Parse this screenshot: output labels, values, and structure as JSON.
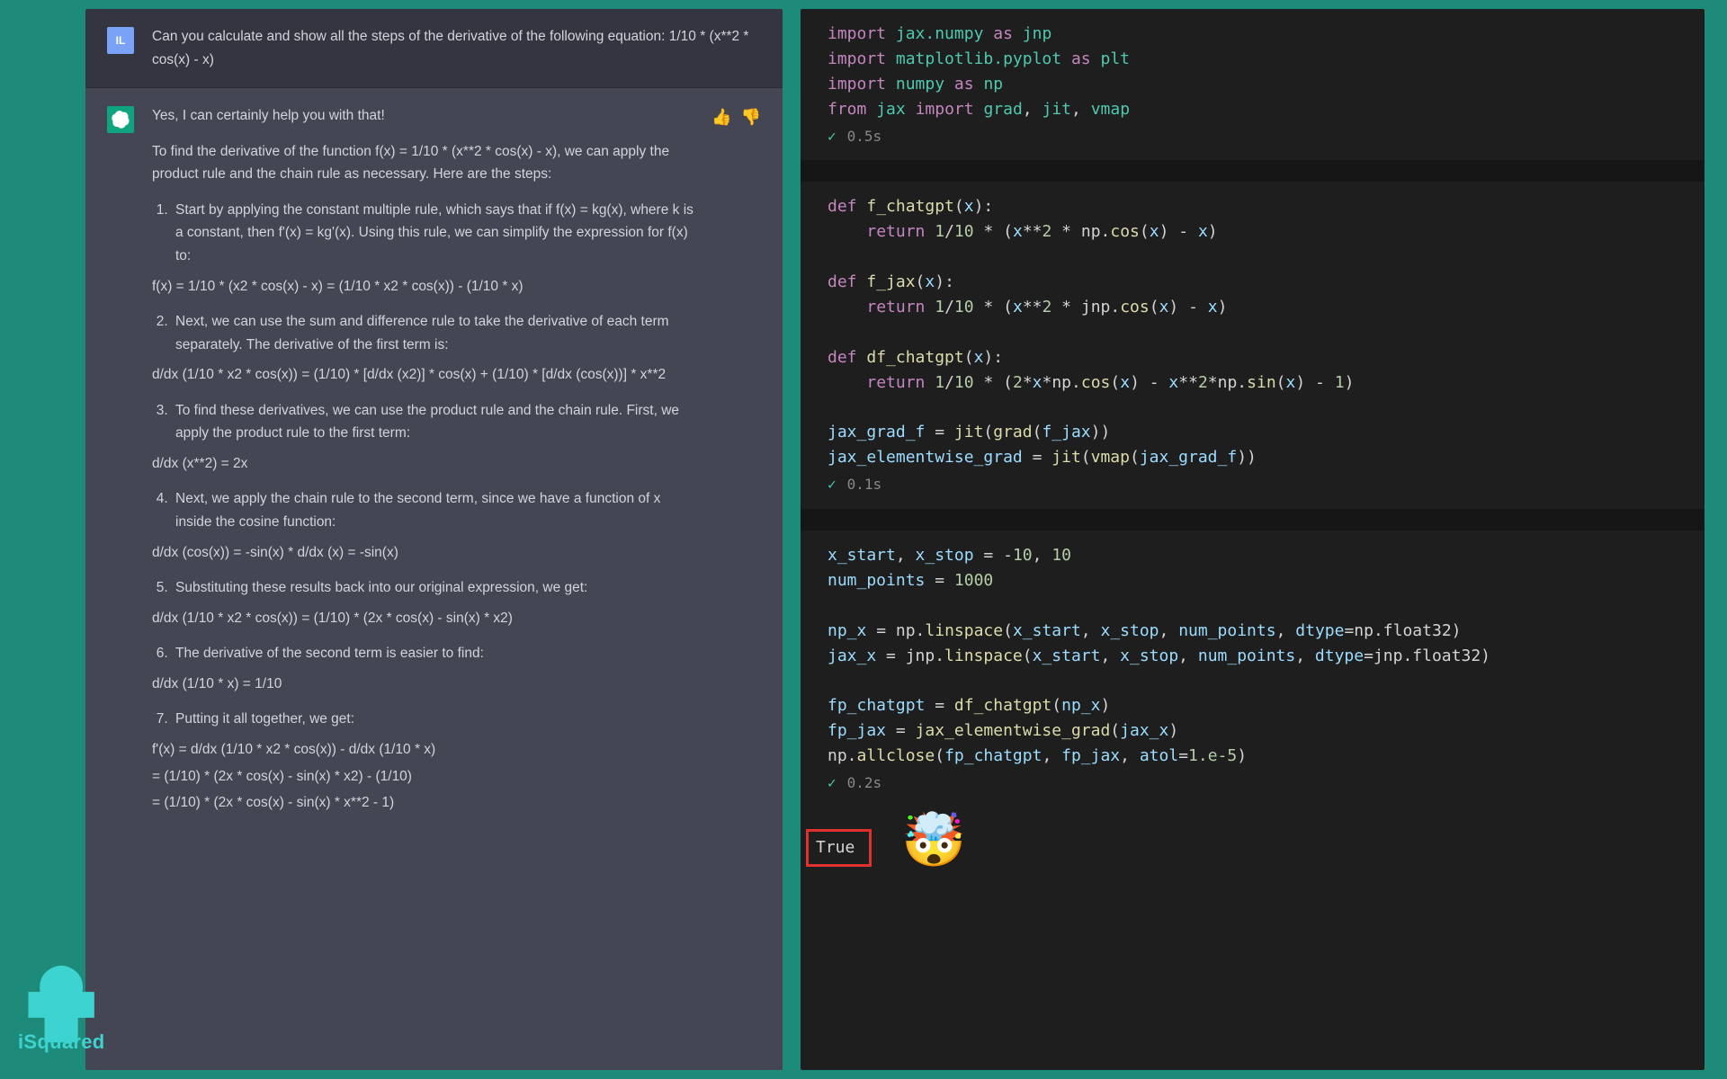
{
  "chat": {
    "user_avatar": "IL",
    "user_prompt": "Can you calculate and show all the steps of the derivative of the following equation: 1/10 * (x**2 * cos(x) - x)",
    "assistant_intro": "Yes, I can certainly help you with that!",
    "assistant_p1": "To find the derivative of the function f(x) = 1/10 * (x**2 * cos(x) - x), we can apply the product rule and the chain rule as necessary. Here are the steps:",
    "steps": {
      "s1": "Start by applying the constant multiple rule, which says that if f(x) = kg(x), where k is a constant, then f'(x) = kg'(x). Using this rule, we can simplify the expression for f(x) to:",
      "e1": "f(x) = 1/10 * (x2 * cos(x) - x) = (1/10 * x2 * cos(x)) - (1/10 * x)",
      "s2": "Next, we can use the sum and difference rule to take the derivative of each term separately. The derivative of the first term is:",
      "e2": "d/dx (1/10 * x2 * cos(x)) = (1/10) * [d/dx (x2)] * cos(x) + (1/10) * [d/dx (cos(x))] * x**2",
      "s3": "To find these derivatives, we can use the product rule and the chain rule. First, we apply the product rule to the first term:",
      "e3": "d/dx (x**2) = 2x",
      "s4": "Next, we apply the chain rule to the second term, since we have a function of x inside the cosine function:",
      "e4": "d/dx (cos(x)) = -sin(x) * d/dx (x) = -sin(x)",
      "s5": "Substituting these results back into our original expression, we get:",
      "e5": "d/dx (1/10 * x2 * cos(x)) = (1/10) * (2x * cos(x) - sin(x) * x2)",
      "s6": "The derivative of the second term is easier to find:",
      "e6": "d/dx (1/10 * x) = 1/10",
      "s7": "Putting it all together, we get:",
      "e7a": "f'(x) = d/dx (1/10 * x2 * cos(x)) - d/dx (1/10 * x)",
      "e7b": "= (1/10) * (2x * cos(x) - sin(x) * x2) - (1/10)",
      "e7c": "= (1/10) * (2x * cos(x) - sin(x) * x**2 - 1)"
    }
  },
  "code": {
    "cell1_time": "0.5s",
    "cell2_time": "0.1s",
    "cell3_time": "0.2s",
    "output_value": "True",
    "emoji": "🤯"
  },
  "logo_text": "iSquared"
}
